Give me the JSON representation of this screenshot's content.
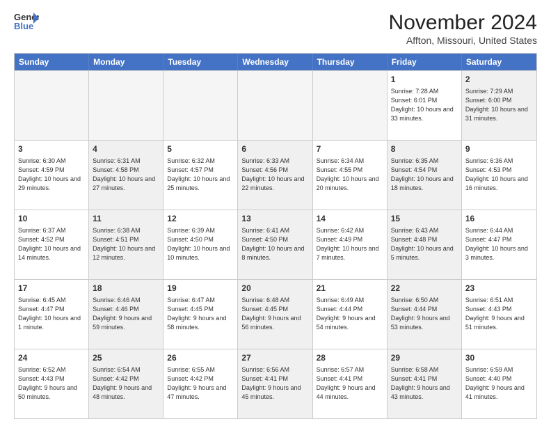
{
  "logo": {
    "line1": "General",
    "line2": "Blue"
  },
  "title": "November 2024",
  "location": "Affton, Missouri, United States",
  "days": [
    "Sunday",
    "Monday",
    "Tuesday",
    "Wednesday",
    "Thursday",
    "Friday",
    "Saturday"
  ],
  "rows": [
    [
      {
        "day": "",
        "info": "",
        "shaded": true,
        "empty": true
      },
      {
        "day": "",
        "info": "",
        "shaded": true,
        "empty": true
      },
      {
        "day": "",
        "info": "",
        "shaded": true,
        "empty": true
      },
      {
        "day": "",
        "info": "",
        "shaded": true,
        "empty": true
      },
      {
        "day": "",
        "info": "",
        "shaded": true,
        "empty": true
      },
      {
        "day": "1",
        "info": "Sunrise: 7:28 AM\nSunset: 6:01 PM\nDaylight: 10 hours and 33 minutes.",
        "shaded": false
      },
      {
        "day": "2",
        "info": "Sunrise: 7:29 AM\nSunset: 6:00 PM\nDaylight: 10 hours and 31 minutes.",
        "shaded": true
      }
    ],
    [
      {
        "day": "3",
        "info": "Sunrise: 6:30 AM\nSunset: 4:59 PM\nDaylight: 10 hours and 29 minutes.",
        "shaded": false
      },
      {
        "day": "4",
        "info": "Sunrise: 6:31 AM\nSunset: 4:58 PM\nDaylight: 10 hours and 27 minutes.",
        "shaded": true
      },
      {
        "day": "5",
        "info": "Sunrise: 6:32 AM\nSunset: 4:57 PM\nDaylight: 10 hours and 25 minutes.",
        "shaded": false
      },
      {
        "day": "6",
        "info": "Sunrise: 6:33 AM\nSunset: 4:56 PM\nDaylight: 10 hours and 22 minutes.",
        "shaded": true
      },
      {
        "day": "7",
        "info": "Sunrise: 6:34 AM\nSunset: 4:55 PM\nDaylight: 10 hours and 20 minutes.",
        "shaded": false
      },
      {
        "day": "8",
        "info": "Sunrise: 6:35 AM\nSunset: 4:54 PM\nDaylight: 10 hours and 18 minutes.",
        "shaded": true
      },
      {
        "day": "9",
        "info": "Sunrise: 6:36 AM\nSunset: 4:53 PM\nDaylight: 10 hours and 16 minutes.",
        "shaded": false
      }
    ],
    [
      {
        "day": "10",
        "info": "Sunrise: 6:37 AM\nSunset: 4:52 PM\nDaylight: 10 hours and 14 minutes.",
        "shaded": false
      },
      {
        "day": "11",
        "info": "Sunrise: 6:38 AM\nSunset: 4:51 PM\nDaylight: 10 hours and 12 minutes.",
        "shaded": true
      },
      {
        "day": "12",
        "info": "Sunrise: 6:39 AM\nSunset: 4:50 PM\nDaylight: 10 hours and 10 minutes.",
        "shaded": false
      },
      {
        "day": "13",
        "info": "Sunrise: 6:41 AM\nSunset: 4:50 PM\nDaylight: 10 hours and 8 minutes.",
        "shaded": true
      },
      {
        "day": "14",
        "info": "Sunrise: 6:42 AM\nSunset: 4:49 PM\nDaylight: 10 hours and 7 minutes.",
        "shaded": false
      },
      {
        "day": "15",
        "info": "Sunrise: 6:43 AM\nSunset: 4:48 PM\nDaylight: 10 hours and 5 minutes.",
        "shaded": true
      },
      {
        "day": "16",
        "info": "Sunrise: 6:44 AM\nSunset: 4:47 PM\nDaylight: 10 hours and 3 minutes.",
        "shaded": false
      }
    ],
    [
      {
        "day": "17",
        "info": "Sunrise: 6:45 AM\nSunset: 4:47 PM\nDaylight: 10 hours and 1 minute.",
        "shaded": false
      },
      {
        "day": "18",
        "info": "Sunrise: 6:46 AM\nSunset: 4:46 PM\nDaylight: 9 hours and 59 minutes.",
        "shaded": true
      },
      {
        "day": "19",
        "info": "Sunrise: 6:47 AM\nSunset: 4:45 PM\nDaylight: 9 hours and 58 minutes.",
        "shaded": false
      },
      {
        "day": "20",
        "info": "Sunrise: 6:48 AM\nSunset: 4:45 PM\nDaylight: 9 hours and 56 minutes.",
        "shaded": true
      },
      {
        "day": "21",
        "info": "Sunrise: 6:49 AM\nSunset: 4:44 PM\nDaylight: 9 hours and 54 minutes.",
        "shaded": false
      },
      {
        "day": "22",
        "info": "Sunrise: 6:50 AM\nSunset: 4:44 PM\nDaylight: 9 hours and 53 minutes.",
        "shaded": true
      },
      {
        "day": "23",
        "info": "Sunrise: 6:51 AM\nSunset: 4:43 PM\nDaylight: 9 hours and 51 minutes.",
        "shaded": false
      }
    ],
    [
      {
        "day": "24",
        "info": "Sunrise: 6:52 AM\nSunset: 4:43 PM\nDaylight: 9 hours and 50 minutes.",
        "shaded": false
      },
      {
        "day": "25",
        "info": "Sunrise: 6:54 AM\nSunset: 4:42 PM\nDaylight: 9 hours and 48 minutes.",
        "shaded": true
      },
      {
        "day": "26",
        "info": "Sunrise: 6:55 AM\nSunset: 4:42 PM\nDaylight: 9 hours and 47 minutes.",
        "shaded": false
      },
      {
        "day": "27",
        "info": "Sunrise: 6:56 AM\nSunset: 4:41 PM\nDaylight: 9 hours and 45 minutes.",
        "shaded": true
      },
      {
        "day": "28",
        "info": "Sunrise: 6:57 AM\nSunset: 4:41 PM\nDaylight: 9 hours and 44 minutes.",
        "shaded": false
      },
      {
        "day": "29",
        "info": "Sunrise: 6:58 AM\nSunset: 4:41 PM\nDaylight: 9 hours and 43 minutes.",
        "shaded": true
      },
      {
        "day": "30",
        "info": "Sunrise: 6:59 AM\nSunset: 4:40 PM\nDaylight: 9 hours and 41 minutes.",
        "shaded": false
      }
    ]
  ]
}
